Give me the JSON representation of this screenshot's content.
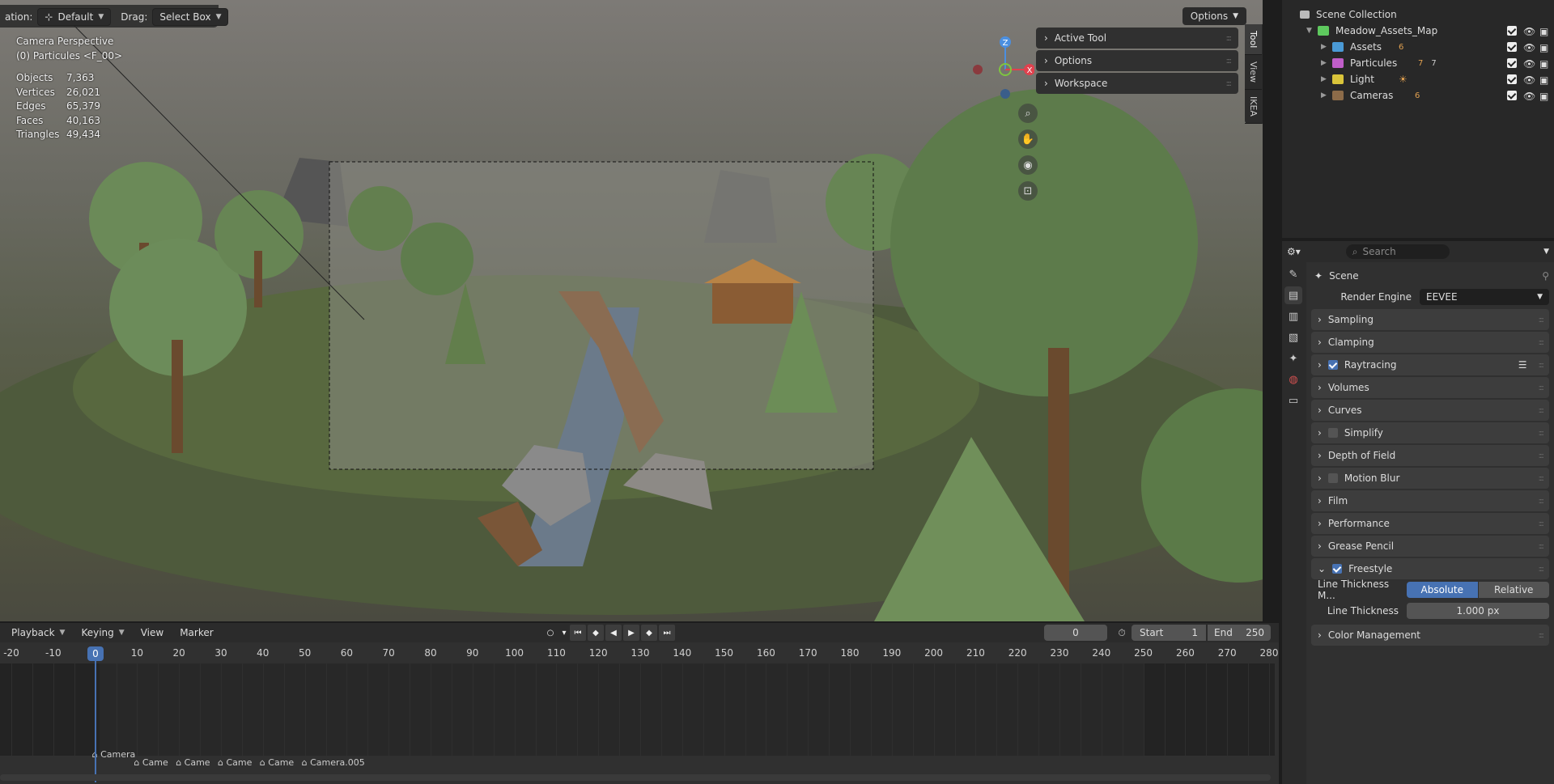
{
  "viewport": {
    "mode_label": "ation:",
    "mode_value": "Default",
    "drag_label": "Drag:",
    "drag_value": "Select Box",
    "options_label": "Options",
    "camera_line1": "Camera Perspective",
    "camera_line2": "(0) Particules <F_00>",
    "stats": [
      {
        "k": "Objects",
        "v": "7,363"
      },
      {
        "k": "Vertices",
        "v": "26,021"
      },
      {
        "k": "Edges",
        "v": "65,379"
      },
      {
        "k": "Faces",
        "v": "40,163"
      },
      {
        "k": "Triangles",
        "v": "49,434"
      }
    ],
    "n_panel": [
      "Active Tool",
      "Options",
      "Workspace"
    ],
    "n_tabs": [
      "Tool",
      "View",
      "IKEA"
    ],
    "gizmo": {
      "z": "Z",
      "x": "X"
    }
  },
  "timeline": {
    "menus": [
      "Playback",
      "Keying",
      "View",
      "Marker"
    ],
    "current_frame": "0",
    "start_label": "Start",
    "start_value": "1",
    "end_label": "End",
    "end_value": "250",
    "ruler": [
      "-20",
      "-10",
      "0",
      "10",
      "20",
      "30",
      "40",
      "50",
      "60",
      "70",
      "80",
      "90",
      "100",
      "110",
      "120",
      "130",
      "140",
      "150",
      "160",
      "170",
      "180",
      "190",
      "200",
      "210",
      "220",
      "230",
      "240",
      "250",
      "260",
      "270",
      "280"
    ],
    "markers": [
      {
        "label": "Camera",
        "frame": 0
      },
      {
        "label": "Came",
        "frame": 10
      },
      {
        "label": "Came",
        "frame": 20
      },
      {
        "label": "Came",
        "frame": 30
      },
      {
        "label": "Came",
        "frame": 40
      },
      {
        "label": "Camera.005",
        "frame": 50
      }
    ]
  },
  "outliner": {
    "root": "Scene Collection",
    "collection": "Meadow_Assets_Map",
    "children": [
      {
        "name": "Assets",
        "badge": "6",
        "color": "#4a9ad6"
      },
      {
        "name": "Particules",
        "badge": "7",
        "badge2": "7",
        "color": "#c05ec9"
      },
      {
        "name": "Light",
        "badge": "",
        "color": "#d9c43a"
      },
      {
        "name": "Cameras",
        "badge": "6",
        "color": "#8c6b49"
      }
    ]
  },
  "properties": {
    "search_placeholder": "Search",
    "context": "Scene",
    "render_engine_label": "Render Engine",
    "render_engine_value": "EEVEE",
    "sections": [
      {
        "label": "Sampling",
        "check": null
      },
      {
        "label": "Clamping",
        "check": null
      },
      {
        "label": "Raytracing",
        "check": true
      },
      {
        "label": "Volumes",
        "check": null
      },
      {
        "label": "Curves",
        "check": null
      },
      {
        "label": "Simplify",
        "check": false
      },
      {
        "label": "Depth of Field",
        "check": null
      },
      {
        "label": "Motion Blur",
        "check": false
      },
      {
        "label": "Film",
        "check": null
      },
      {
        "label": "Performance",
        "check": null
      },
      {
        "label": "Grease Pencil",
        "check": null
      }
    ],
    "freestyle": {
      "label": "Freestyle",
      "line_thickness_mode_label": "Line Thickness M...",
      "mode_options": [
        "Absolute",
        "Relative"
      ],
      "line_thickness_label": "Line Thickness",
      "line_thickness_value": "1.000 px"
    },
    "color_management": "Color Management"
  }
}
